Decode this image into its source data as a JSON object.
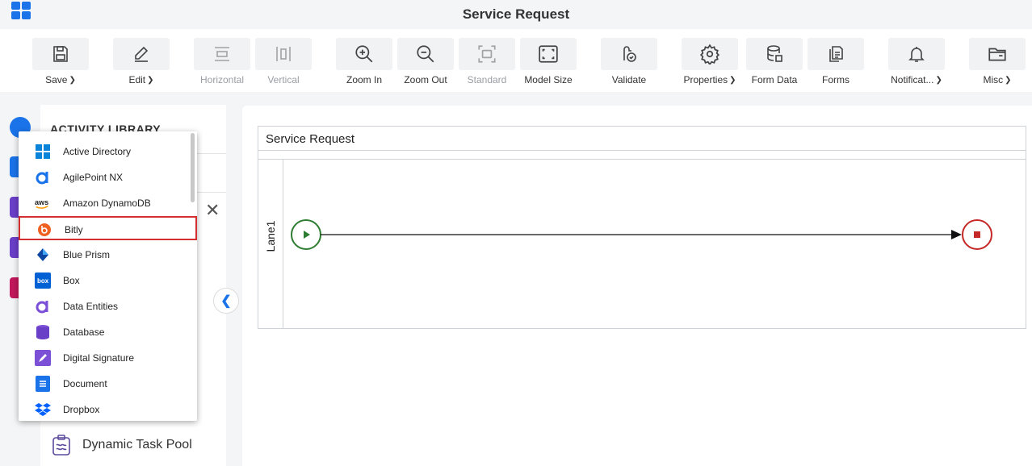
{
  "app": {
    "title": "Service Request"
  },
  "toolbar": {
    "save": "Save",
    "edit": "Edit",
    "horizontal": "Horizontal",
    "vertical": "Vertical",
    "zoom_in": "Zoom In",
    "zoom_out": "Zoom Out",
    "standard": "Standard",
    "model_size": "Model Size",
    "validate": "Validate",
    "properties": "Properties",
    "form_data": "Form Data",
    "forms": "Forms",
    "notifications": "Notificat...",
    "misc": "Misc"
  },
  "library": {
    "title": "ACTIVITY LIBRARY",
    "bottom_item": "Dynamic Task Pool"
  },
  "dropdown": {
    "selected": "Bitly",
    "items": [
      {
        "label": "Active Directory",
        "icon": "windows-icon"
      },
      {
        "label": "AgilePoint NX",
        "icon": "agilepoint-icon"
      },
      {
        "label": "Amazon DynamoDB",
        "icon": "aws-icon"
      },
      {
        "label": "Bitly",
        "icon": "bitly-icon"
      },
      {
        "label": "Blue Prism",
        "icon": "blue-prism-icon"
      },
      {
        "label": "Box",
        "icon": "box-icon"
      },
      {
        "label": "Data Entities",
        "icon": "data-entities-icon"
      },
      {
        "label": "Database",
        "icon": "database-icon"
      },
      {
        "label": "Digital Signature",
        "icon": "digital-signature-icon"
      },
      {
        "label": "Document",
        "icon": "document-icon"
      },
      {
        "label": "Dropbox",
        "icon": "dropbox-icon"
      }
    ],
    "aws_text": "aws",
    "box_text": "box"
  },
  "diagram": {
    "pool_title": "Service Request",
    "lane_label": "Lane1"
  },
  "colors": {
    "accent": "#1a73e8",
    "start_event": "#2e7d32",
    "end_event": "#c62828",
    "selection": "#d32f2f"
  }
}
